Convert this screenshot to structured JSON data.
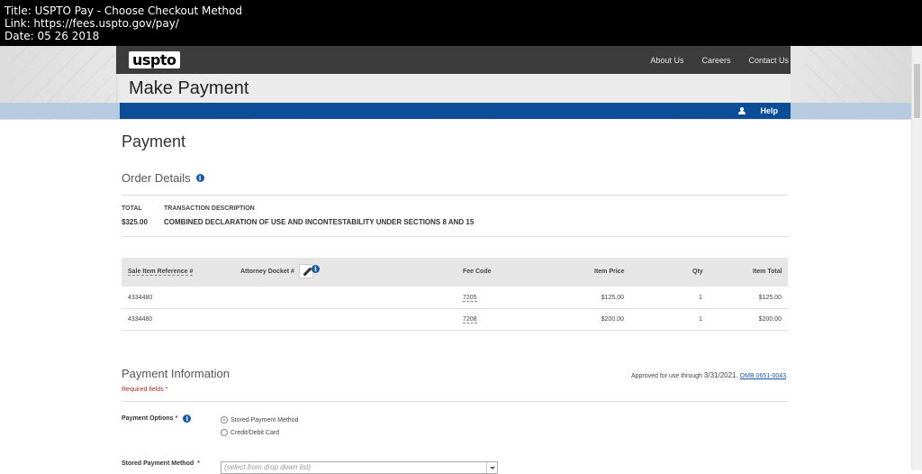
{
  "capture": {
    "title": "Title: USPTO Pay - Choose Checkout Method",
    "link": "Link: https://fees.uspto.gov/pay/",
    "date": "Date: 05 26 2018"
  },
  "header": {
    "logo": "uspto",
    "nav": [
      "About Us",
      "Careers",
      "Contact Us"
    ],
    "page_title": "Make Payment",
    "help": "Help"
  },
  "main": {
    "title": "Payment",
    "order_details": {
      "heading": "Order Details",
      "total_label": "TOTAL",
      "total_value": "$325.00",
      "desc_label": "TRANSACTION DESCRIPTION",
      "desc_value": "COMBINED DECLARATION OF USE AND INCONTESTABILITY UNDER SECTIONS 8 AND 15"
    },
    "items_table": {
      "columns": [
        "Sale Item Reference #",
        "Attorney Docket #",
        "Fee Code",
        "Item Price",
        "Qty",
        "Item Total"
      ],
      "rows": [
        {
          "ref": "4334480",
          "docket": "",
          "fee_code": "7205",
          "price": "$125.00",
          "qty": "1",
          "total": "$125.00"
        },
        {
          "ref": "4334480",
          "docket": "",
          "fee_code": "7208",
          "price": "$200.00",
          "qty": "1",
          "total": "$200.00"
        }
      ]
    },
    "payment_info": {
      "heading": "Payment Information",
      "required": "Required fields *",
      "approved_prefix": "Approved for use through",
      "approved_date": "3/31/2021.",
      "omb": "OMB 0651-0043",
      "options_label": "Payment Options",
      "options": [
        "Stored Payment Method",
        "Credit/Debit Card"
      ],
      "selected_option": "Stored Payment Method",
      "stored_label": "Stored Payment Method",
      "stored_placeholder": "(select from drop down list)"
    }
  },
  "colors": {
    "nav_bar": "#3c3c3c",
    "blue_bar": "#0b4d96",
    "required": "#a52a2a",
    "link": "#1a57a0"
  }
}
